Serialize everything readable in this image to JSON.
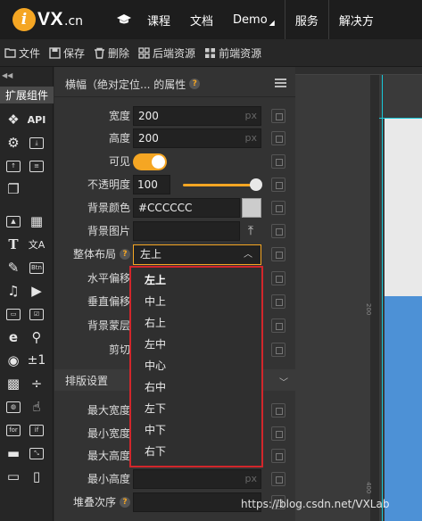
{
  "nav": {
    "logo_letter": "i",
    "logo_text": "VX",
    "logo_suffix": ".cn",
    "items": [
      "课程",
      "文档",
      "Demo",
      "服务",
      "解决方"
    ]
  },
  "toolbar": {
    "buttons": [
      {
        "label": "文件",
        "icon": "folder-icon"
      },
      {
        "label": "保存",
        "icon": "save-icon"
      },
      {
        "label": "删除",
        "icon": "trash-icon"
      },
      {
        "label": "后端资源",
        "icon": "grid-icon"
      },
      {
        "label": "前端资源",
        "icon": "grid-icon"
      }
    ]
  },
  "leftcol": {
    "tab_label": "扩展组件",
    "api_label": "API",
    "btn_label": "Btn",
    "number_label": "±1",
    "for_label": "for",
    "if_label": "if"
  },
  "panel": {
    "title": "横幅（绝对定位... 的属性",
    "width_label": "宽度",
    "width_value": "200",
    "height_label": "高度",
    "height_value": "200",
    "visible_label": "可见",
    "opacity_label": "不透明度",
    "opacity_value": "100",
    "bgcolor_label": "背景颜色",
    "bgcolor_value": "#CCCCCC",
    "bgimage_label": "背景图片",
    "layout_label": "整体布局",
    "layout_value": "左上",
    "hoffset_label": "水平偏移",
    "voffset_label": "垂直偏移",
    "bglayer_label": "背景蒙层",
    "clip_label": "剪切",
    "section_title": "排版设置",
    "maxwidth_label": "最大宽度",
    "minwidth_label": "最小宽度",
    "maxheight_label": "最大高度",
    "minheight_label": "最小高度",
    "zindex_label": "堆叠次序",
    "unit_px": "px",
    "unit_percent": "%"
  },
  "dropdown": {
    "options": [
      "左上",
      "中上",
      "右上",
      "左中",
      "中心",
      "右中",
      "左下",
      "中下",
      "右下"
    ],
    "selected": "左上"
  },
  "canvas": {
    "ruler_200": "200",
    "ruler_400": "400"
  },
  "watermark": "https://blog.csdn.net/VXLab",
  "colors": {
    "accent": "#f5a623",
    "highlight_border": "#d2262b",
    "stage_blue": "#4d91d6"
  }
}
